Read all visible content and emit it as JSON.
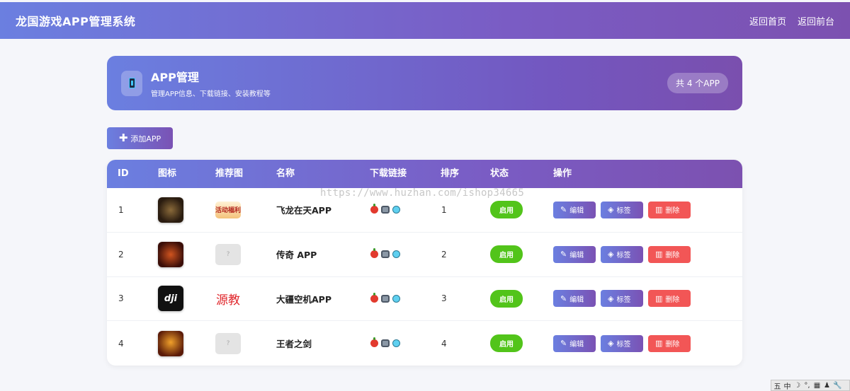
{
  "topbar": {
    "brand": "龙国游戏APP管理系统",
    "links": [
      "返回首页",
      "返回前台"
    ]
  },
  "hero": {
    "title": "APP管理",
    "subtitle": "管理APP信息、下载链接、安装教程等",
    "count_label": "共 4 个APP",
    "icon": "phone-icon"
  },
  "toolbar": {
    "add_label": "添加APP"
  },
  "table": {
    "columns": [
      "ID",
      "图标",
      "推荐图",
      "名称",
      "下载链接",
      "排序",
      "状态",
      "操作"
    ],
    "rows": [
      {
        "id": "1",
        "name": "飞龙在天APP",
        "sort": "1",
        "status": "启用",
        "rec_text": "活动福利"
      },
      {
        "id": "2",
        "name": "传奇 APP",
        "sort": "2",
        "status": "启用",
        "rec_text": "?"
      },
      {
        "id": "3",
        "name": "大疆空机APP",
        "sort": "3",
        "status": "启用",
        "rec_text": "源教",
        "icon_text": "dji"
      },
      {
        "id": "4",
        "name": "王者之剑",
        "sort": "4",
        "status": "启用",
        "rec_text": "?"
      }
    ],
    "actions": {
      "edit": "编辑",
      "tag": "标签",
      "delete": "删除"
    }
  },
  "watermark": "https://www.huzhan.com/ishop34665",
  "tray": [
    "五",
    "中",
    "☽",
    "°,",
    "▦",
    "♟",
    "🔧"
  ],
  "colors": {
    "accent": "#6b7fe0",
    "accent2": "#7c51b0",
    "success": "#52c41a",
    "danger": "#f25656"
  }
}
